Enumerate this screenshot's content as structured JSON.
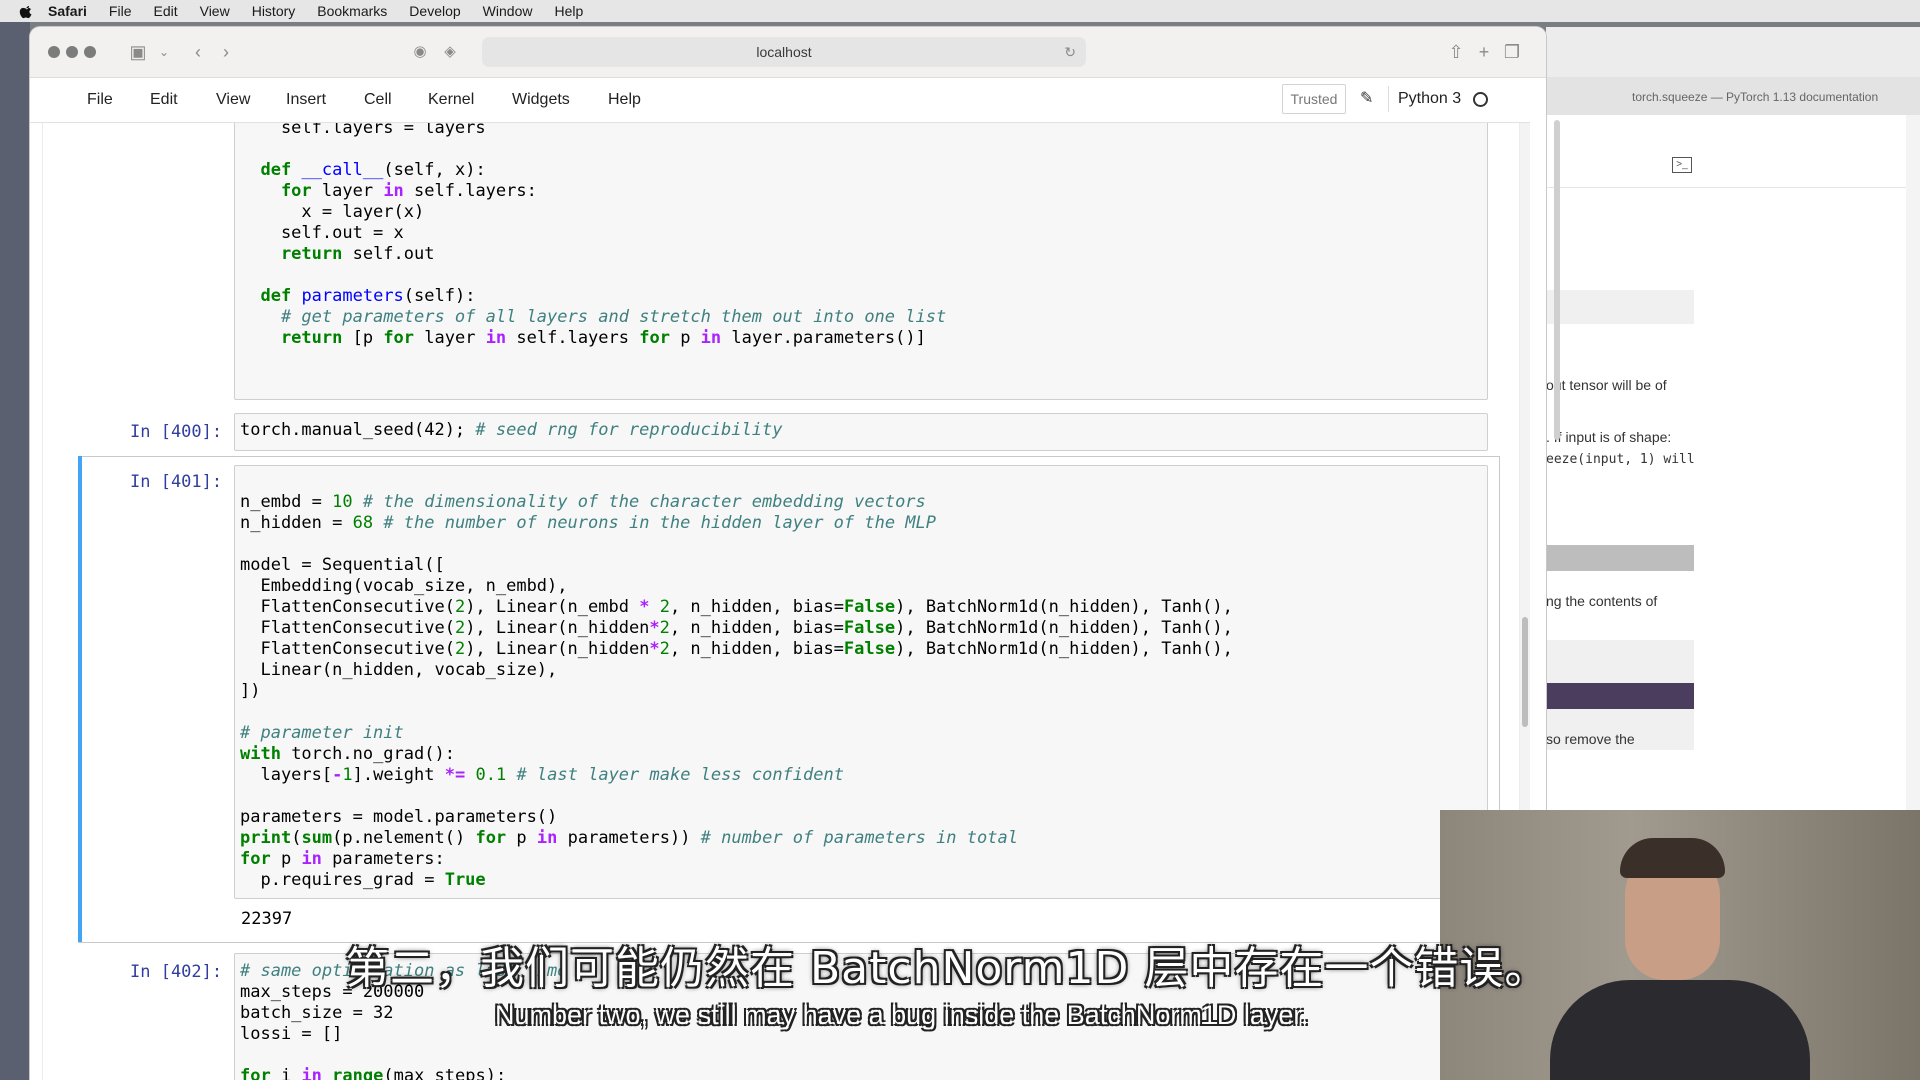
{
  "menubar": {
    "app": "Safari",
    "items": [
      "File",
      "Edit",
      "View",
      "History",
      "Bookmarks",
      "Develop",
      "Window",
      "Help"
    ]
  },
  "browser": {
    "address": "localhost",
    "background_tab_title": "torch.squeeze — PyTorch 1.13 documentation"
  },
  "jupyter": {
    "menu": [
      "File",
      "Edit",
      "View",
      "Insert",
      "Cell",
      "Kernel",
      "Widgets",
      "Help"
    ],
    "trusted_label": "Trusted",
    "kernel_name": "Python 3"
  },
  "cells": {
    "c399": {
      "lines": [
        "    self.layers = layers",
        "",
        "  def __call__(self, x):",
        "    for layer in self.layers:",
        "      x = layer(x)",
        "    self.out = x",
        "    return self.out",
        "",
        "  def parameters(self):",
        "    # get parameters of all layers and stretch them out into one list",
        "    return [p for layer in self.layers for p in layer.parameters()]"
      ]
    },
    "c400": {
      "prompt": "In [400]:",
      "code": "torch.manual_seed(42);",
      "comment": " # seed rng for reproducibility"
    },
    "c401": {
      "prompt": "In [401]:",
      "lines": [
        "n_embd = 10 # the dimensionality of the character embedding vectors",
        "n_hidden = 68 # the number of neurons in the hidden layer of the MLP",
        "",
        "model = Sequential([",
        "  Embedding(vocab_size, n_embd),",
        "  FlattenConsecutive(2), Linear(n_embd * 2, n_hidden, bias=False), BatchNorm1d(n_hidden), Tanh(),",
        "  FlattenConsecutive(2), Linear(n_hidden*2, n_hidden, bias=False), BatchNorm1d(n_hidden), Tanh(),",
        "  FlattenConsecutive(2), Linear(n_hidden*2, n_hidden, bias=False), BatchNorm1d(n_hidden), Tanh(),",
        "  Linear(n_hidden, vocab_size),",
        "])",
        "",
        "# parameter init",
        "with torch.no_grad():",
        "  layers[-1].weight *= 0.1 # last layer make less confident",
        "",
        "parameters = model.parameters()",
        "print(sum(p.nelement() for p in parameters)) # number of parameters in total",
        "for p in parameters:",
        "  p.requires_grad = True"
      ],
      "output": "22397"
    },
    "c402": {
      "prompt": "In [402]:",
      "lines": [
        "# same optimization as last time",
        "max_steps = 200000",
        "batch_size = 32",
        "lossi = []",
        "",
        "for i in range(max_steps):"
      ]
    }
  },
  "docs_fragments": [
    "out tensor will be of",
    ". If input is of shape:",
    "eeze(input, 1) will",
    "ng the contents of",
    "so remove the"
  ],
  "subtitles": {
    "chinese": "第二，我们可能仍然在 BatchNorm1D 层中存在一个错误。",
    "english": "Number two, we still may have a bug inside the BatchNorm1D layer."
  }
}
